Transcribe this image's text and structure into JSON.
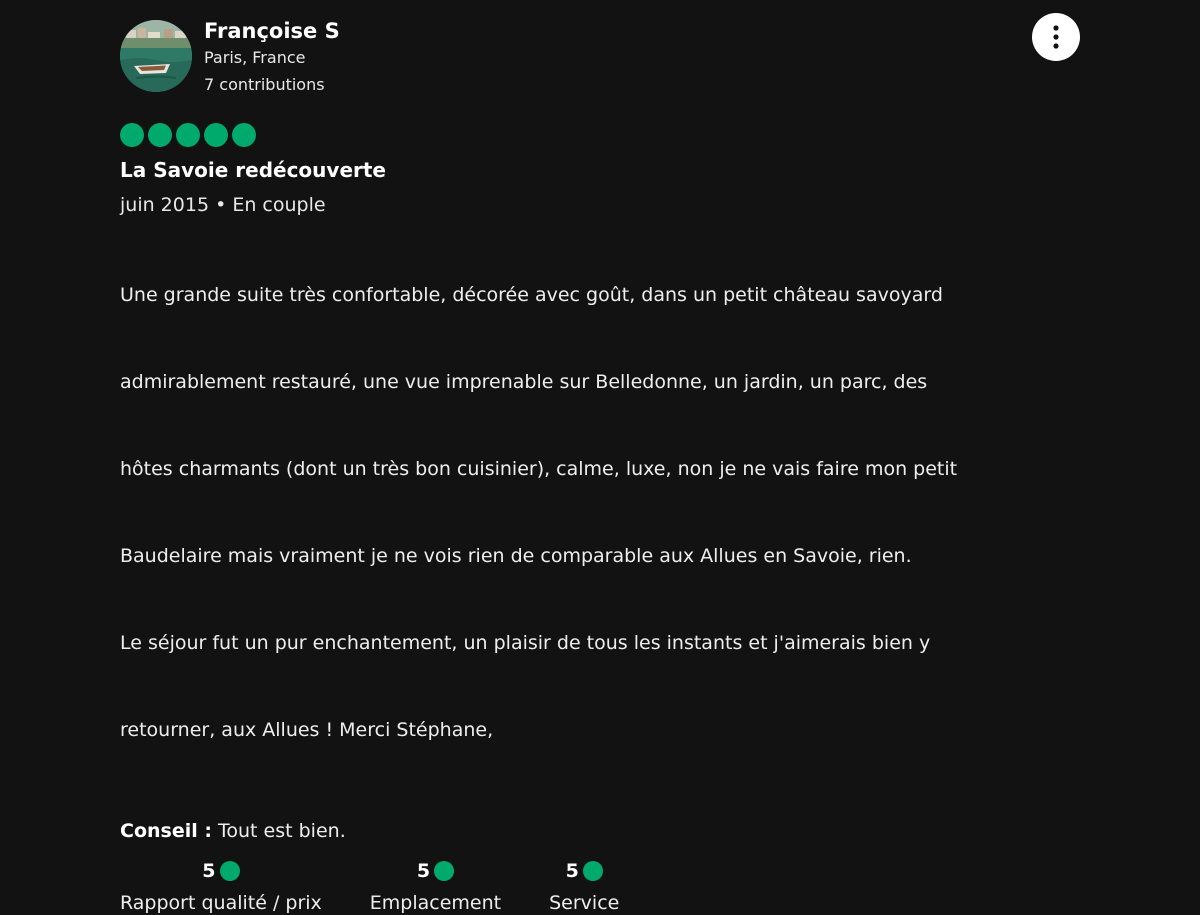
{
  "user": {
    "name": "Françoise S",
    "location": "Paris, France",
    "contributions": "7 contributions",
    "avatar_icon": "avatar-boat-photo"
  },
  "menu": {
    "icon": "more-vertical-icon"
  },
  "review": {
    "rating": 5,
    "rating_max": 5,
    "title": "La Savoie redécouverte",
    "meta": "juin 2015 • En couple",
    "body_lines": [
      "Une grande suite très confortable, décorée avec goût, dans un petit château savoyard",
      "admirablement restauré, une vue imprenable sur Belledonne, un jardin, un parc, des",
      "hôtes charmants (dont un très bon cuisinier), calme, luxe, non je ne vais faire mon petit",
      "Baudelaire mais vraiment je ne vois rien de comparable aux Allues en Savoie, rien.",
      "Le séjour fut un pur enchantement, un plaisir de tous les instants et j'aimerais bien y",
      "retourner, aux Allues ! Merci Stéphane,"
    ],
    "tip_label": "Conseil :",
    "tip_text": " Tout est bien."
  },
  "sub_ratings": [
    {
      "score": "5",
      "label": "Rapport qualité / prix"
    },
    {
      "score": "5",
      "label": "Emplacement"
    },
    {
      "score": "5",
      "label": "Service"
    }
  ],
  "colors": {
    "background": "#121212",
    "bubble": "#00aa6c",
    "text": "#ffffff"
  }
}
